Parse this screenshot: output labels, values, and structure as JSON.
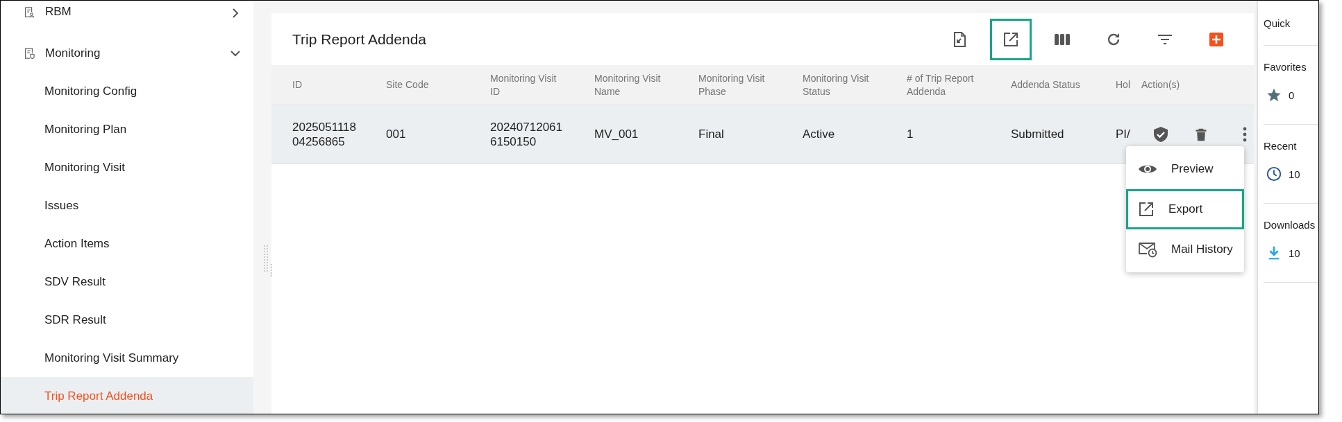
{
  "sidebar": {
    "items": [
      {
        "label": "RBM",
        "expanded": false
      },
      {
        "label": "Monitoring",
        "expanded": true,
        "children": [
          {
            "label": "Monitoring Config",
            "selected": false
          },
          {
            "label": "Monitoring Plan",
            "selected": false
          },
          {
            "label": "Monitoring Visit",
            "selected": false
          },
          {
            "label": "Issues",
            "selected": false
          },
          {
            "label": "Action Items",
            "selected": false
          },
          {
            "label": "SDV Result",
            "selected": false
          },
          {
            "label": "SDR Result",
            "selected": false
          },
          {
            "label": "Monitoring Visit Summary",
            "selected": false
          },
          {
            "label": "Trip Report Addenda",
            "selected": true
          }
        ]
      }
    ]
  },
  "page": {
    "title": "Trip Report Addenda",
    "toolbar": [
      {
        "kind": "import",
        "highlighted": false
      },
      {
        "kind": "export",
        "highlighted": true
      },
      {
        "kind": "columns",
        "highlighted": false
      },
      {
        "kind": "refresh",
        "highlighted": false
      },
      {
        "kind": "filter",
        "highlighted": false
      },
      {
        "kind": "add",
        "highlighted": false
      }
    ]
  },
  "table": {
    "columns": [
      "ID",
      "Site Code",
      "Monitoring Visit ID",
      "Monitoring Visit Name",
      "Monitoring Visit Phase",
      "Monitoring Visit Status",
      "# of Trip Report Addenda",
      "Addenda Status",
      "Hol",
      "Action(s)"
    ],
    "rows": [
      {
        "selected": true,
        "cells": [
          "2025051118 04256865",
          "001",
          "20240712061 6150150",
          "MV_001",
          "Final",
          "Active",
          "1",
          "Submitted",
          "PI/"
        ]
      }
    ]
  },
  "row_menu": {
    "items": [
      {
        "kind": "preview",
        "label": "Preview",
        "highlighted": false
      },
      {
        "kind": "export",
        "label": "Export",
        "highlighted": true
      },
      {
        "kind": "mail",
        "label": "Mail History",
        "highlighted": false
      }
    ]
  },
  "quick_panel": {
    "title": "Quick",
    "sections": [
      {
        "kind": "favorites",
        "label": "Favorites",
        "count": "0"
      },
      {
        "kind": "recent",
        "label": "Recent",
        "count": "10"
      },
      {
        "kind": "downloads",
        "label": "Downloads",
        "count": "10"
      }
    ]
  }
}
